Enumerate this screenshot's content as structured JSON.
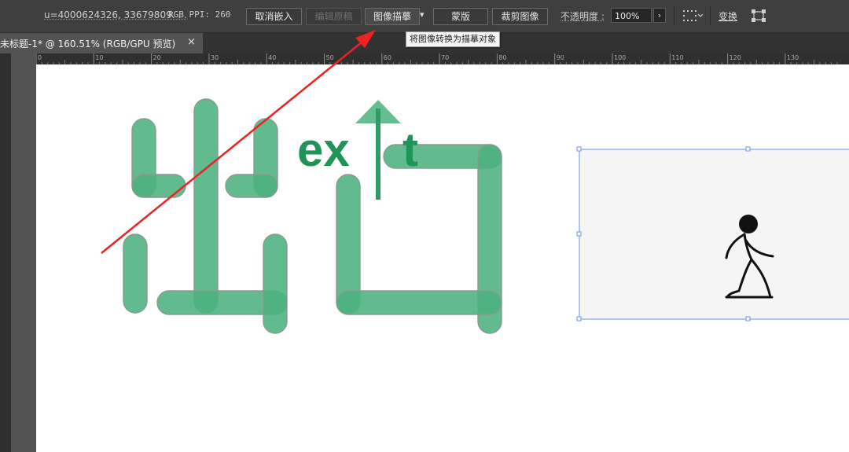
{
  "control_bar": {
    "file_name": "u=4000624326, 33679809. . .",
    "color_info": "RGB  PPI: 260",
    "buttons": {
      "cancel_embed": "取消嵌入",
      "edit_original": "编辑原稿",
      "image_trace": "图像描摹",
      "mask": "蒙版",
      "crop_image": "裁剪图像"
    },
    "opacity_label": "不透明度 :",
    "opacity_value": "100%",
    "transform": "变换",
    "tooltip": "将图像转换为描摹对象"
  },
  "tab": {
    "title": "未标题-1* @ 160.51% (RGB/GPU 预览)",
    "close": "×"
  },
  "ruler": {
    "labels": [
      "0",
      "10",
      "20",
      "30",
      "40",
      "50",
      "60",
      "70",
      "80",
      "90",
      "100",
      "110",
      "120",
      "130"
    ]
  },
  "artwork": {
    "exit_text": "ex",
    "exit_t": "t"
  },
  "colors": {
    "green_stroke": "#4cb27f",
    "exit_text_green": "#1e9456",
    "annotation_red": "#ee2222",
    "selection_blue": "#6d8ff5"
  },
  "icons": {
    "dropdown": "▾",
    "opacity_arrow": "›"
  }
}
